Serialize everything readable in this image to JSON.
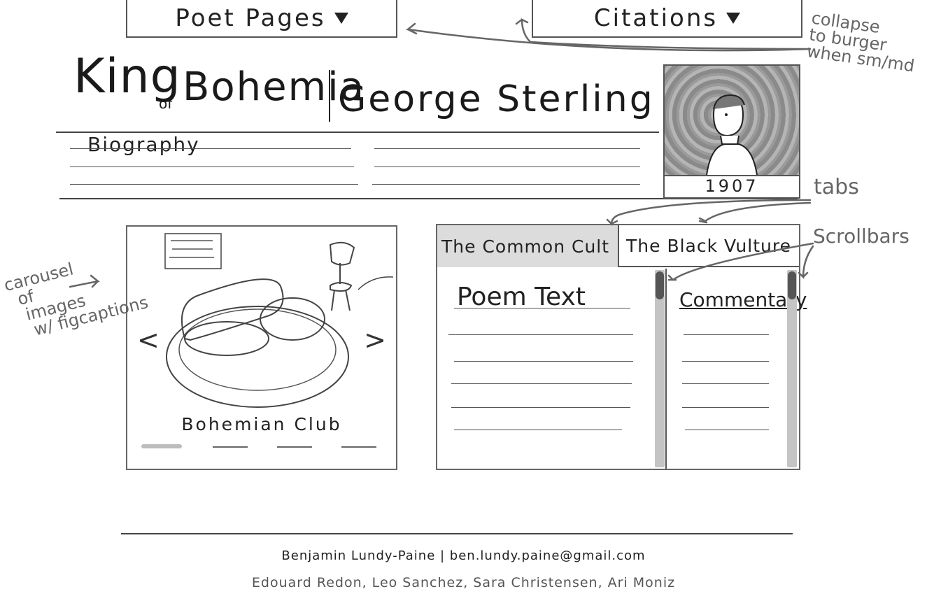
{
  "nav": {
    "poet_pages": "Poet Pages",
    "citations": "Citations"
  },
  "title": {
    "king": "King",
    "of": "of",
    "bohemia": "Bohemia",
    "name": "George Sterling"
  },
  "biography": {
    "label": "Biography"
  },
  "portrait": {
    "year": "1907"
  },
  "carousel": {
    "prev": "<",
    "next": ">",
    "caption": "Bohemian Club",
    "slide_count": 4,
    "active_index": 0
  },
  "tabs": {
    "items": [
      {
        "label": "The Common Cult",
        "active": false
      },
      {
        "label": "The Black Vulture",
        "active": true
      }
    ],
    "poem_title": "Poem Text",
    "commentary_title": "Commentary"
  },
  "annotations": {
    "burger": [
      "collapse",
      "to burger",
      "when sm/md"
    ],
    "tabs": "tabs",
    "scrollbars": "Scrollbars",
    "carousel": [
      "carousel",
      "of",
      "images",
      "w/ figcaptions"
    ]
  },
  "footer": {
    "author": "Benjamin Lundy-Paine | ben.lundy.paine@gmail.com",
    "credits": "Edouard Redon, Leo Sanchez, Sara Christensen, Ari Moniz"
  },
  "colors": {
    "ink": "#222222",
    "annotation": "#666666",
    "inactive_tab": "#dcdcdc",
    "scroll_track": "#c4c4c4"
  }
}
